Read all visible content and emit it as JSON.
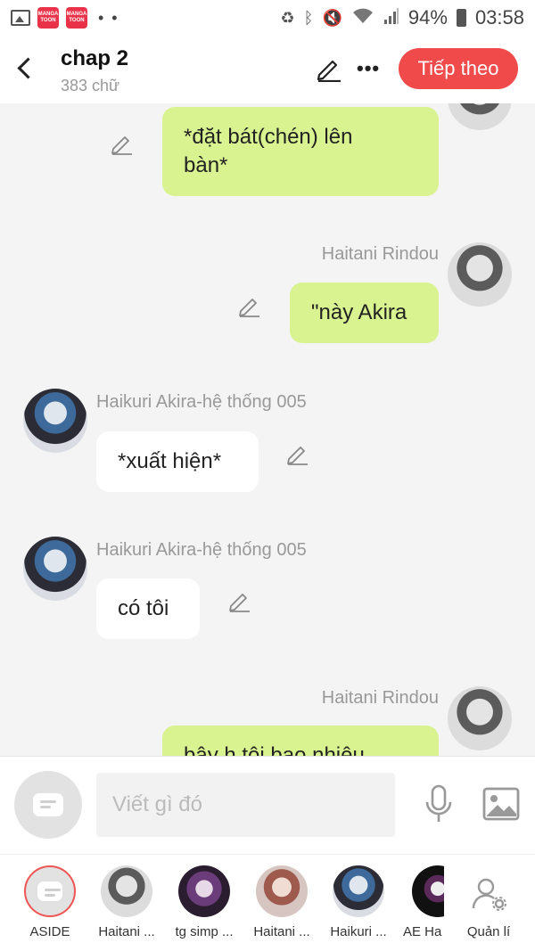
{
  "status_bar": {
    "app_badge_1": "MANGA TOON",
    "app_badge_2": "MANGA TOON",
    "dots": "• •",
    "battery": "94%",
    "time": "03:58"
  },
  "header": {
    "title": "chap 2",
    "word_count": "383 chữ",
    "next_label": "Tiếp theo",
    "more_label": "•••"
  },
  "messages": [
    {
      "speaker": "",
      "side": "right",
      "text_line1": "*đặt bát(chén) lên",
      "text_line2": "bàn*"
    },
    {
      "speaker": "Haitani Rindou",
      "side": "right",
      "text": "\"này Akira"
    },
    {
      "speaker": "Haikuri Akira-hệ thống 005",
      "side": "left",
      "text": "*xuất hiện*"
    },
    {
      "speaker": "Haikuri Akira-hệ thống 005",
      "side": "left",
      "text": "có tôi"
    },
    {
      "speaker": "Haitani Rindou",
      "side": "right",
      "text": "bây h tôi bao nhiêu"
    }
  ],
  "composer": {
    "placeholder": "Viết gì đó"
  },
  "tabs": [
    {
      "label": "ASIDE"
    },
    {
      "label": "Haitani ..."
    },
    {
      "label": "tg simp ..."
    },
    {
      "label": "Haitani ..."
    },
    {
      "label": "Haikuri ..."
    },
    {
      "label": "AE Ha"
    },
    {
      "label": "Quản lí"
    }
  ],
  "colors": {
    "accent": "#f14a4a",
    "own_bubble": "#d8f38f",
    "other_bubble": "#ffffff",
    "background": "#f4f4f4"
  }
}
